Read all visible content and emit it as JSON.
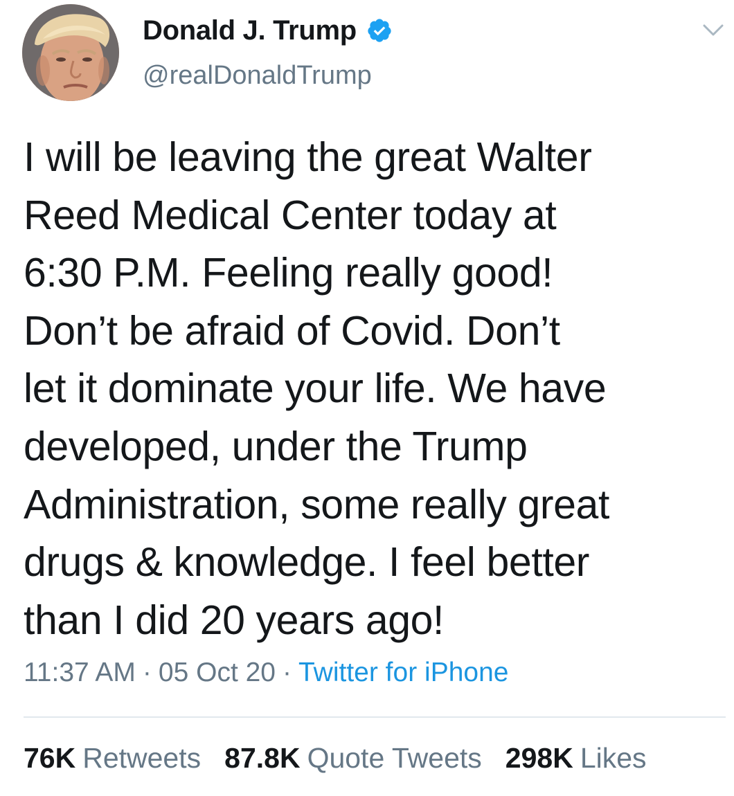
{
  "header": {
    "display_name": "Donald J. Trump",
    "handle": "@realDonaldTrump",
    "verified_icon": "verified-badge-icon",
    "menu_icon": "chevron-down-icon",
    "avatar": "profile-photo"
  },
  "tweet": {
    "text": "I will be leaving the great Walter\nReed Medical Center today at\n6:30 P.M. Feeling really good!\nDon’t be afraid of Covid. Don’t\nlet it dominate your life. We have\ndeveloped, under the Trump\nAdministration, some really great\ndrugs & knowledge. I feel better\nthan I did 20 years ago!"
  },
  "meta": {
    "time": "11:37 AM",
    "separator": "·",
    "date": "05 Oct 20",
    "source": "Twitter for iPhone"
  },
  "stats": {
    "retweets_count": "76K",
    "retweets_label": "Retweets",
    "quotes_count": "87.8K",
    "quotes_label": "Quote Tweets",
    "likes_count": "298K",
    "likes_label": "Likes"
  },
  "colors": {
    "text": "#14171a",
    "secondary": "#657786",
    "link": "#1b95e0",
    "verified": "#1da1f2",
    "divider": "#e1e8ed"
  }
}
